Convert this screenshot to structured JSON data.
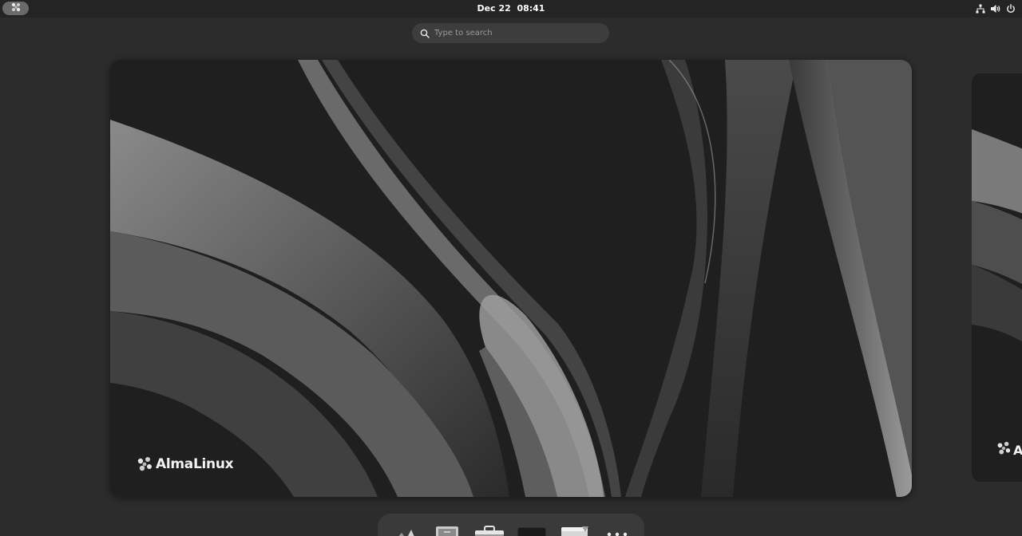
{
  "topbar": {
    "clock": "Dec 22  08:41",
    "activities_icon": "almalinux-logo-icon",
    "tray_icons": [
      "network-wired-icon",
      "volume-icon",
      "power-icon"
    ]
  },
  "search": {
    "placeholder": "Type to search",
    "value": "",
    "icon": "search-icon"
  },
  "workspace": {
    "brand": "AlmaLinux",
    "brand_partial": "A"
  },
  "dash": {
    "apps": [
      {
        "name": "almalinux-apps-icon"
      },
      {
        "name": "text-editor-icon"
      },
      {
        "name": "software-bag-icon"
      },
      {
        "name": "terminal-icon"
      },
      {
        "name": "file-manager-icon"
      },
      {
        "name": "show-apps-grid-icon"
      }
    ]
  },
  "colors": {
    "topbar": "#242424",
    "overview_background": "#2c2c2c",
    "search_field": "#3d3d3d",
    "dash": "#3a3a3a"
  }
}
